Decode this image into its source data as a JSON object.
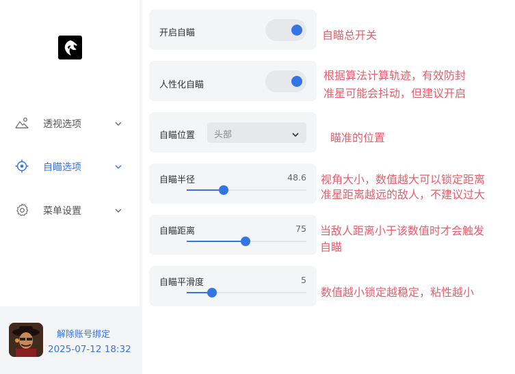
{
  "sidebar": {
    "logo_icon": "wolf-logo-icon",
    "items": [
      {
        "label": "透视选项",
        "icon": "mountain-person-icon",
        "active": false
      },
      {
        "label": "自瞄选项",
        "icon": "crosshair-icon",
        "active": true
      },
      {
        "label": "菜单设置",
        "icon": "gear-icon",
        "active": false
      }
    ],
    "unbind_label": "解除账号绑定",
    "timestamp": "2025-07-12 18:32",
    "avatar_icon": "user-avatar"
  },
  "settings": {
    "aim_enable": {
      "label": "开启自瞄",
      "on": true
    },
    "humanized_aim": {
      "label": "人性化自瞄",
      "on": true
    },
    "aim_position": {
      "label": "自瞄位置",
      "value": "头部"
    },
    "aim_radius": {
      "label": "自瞄半径",
      "value": "48.6",
      "fraction": 0.31
    },
    "aim_distance": {
      "label": "自瞄距离",
      "value": "75",
      "fraction": 0.49
    },
    "aim_smoothness": {
      "label": "自瞄平滑度",
      "value": "5",
      "fraction": 0.21
    }
  },
  "annotations": {
    "aim_enable": "自瞄总开关",
    "humanized_aim_line1": "根据算法计算轨迹，有效防封",
    "humanized_aim_line2": "准星可能会抖动，但建议开启",
    "aim_position": "瞄准的位置",
    "aim_radius_line1": "视角大小，数值越大可以锁定距离",
    "aim_radius_line2": "准星距离越远的敌人，不建议过大",
    "aim_distance_line1": "当敌人距离小于该数值时才会触发",
    "aim_distance_line2": "自瞄",
    "aim_smoothness": "数值越小锁定越稳定，粘性越小"
  },
  "colors": {
    "accent": "#3574e3",
    "annotation": "#e85d6b"
  }
}
